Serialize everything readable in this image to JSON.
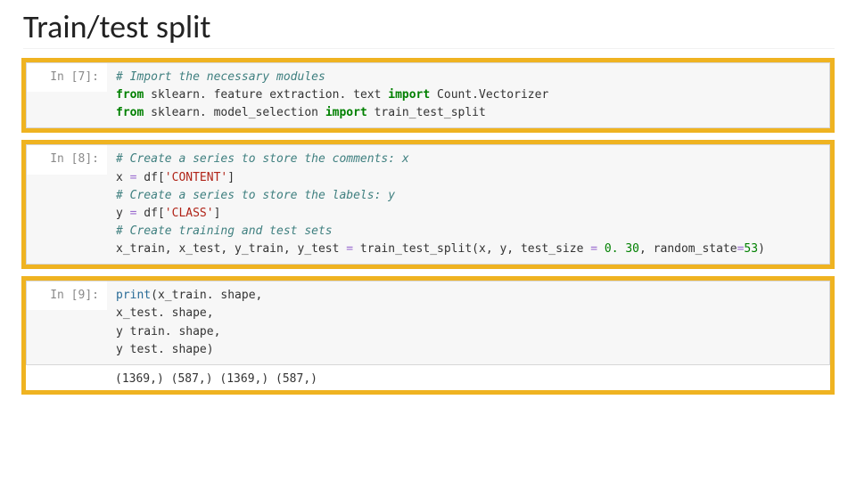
{
  "title": "Train/test split",
  "cells": [
    {
      "prompt": "In [7]:",
      "code": [
        {
          "type": "comment",
          "text": "# Import the necessary modules"
        },
        {
          "type": "import",
          "from": "from",
          "module": " sklearn. feature extraction. text ",
          "import": "import",
          "names": " Count.Vectorizer"
        },
        {
          "type": "import",
          "from": "from",
          "module": " sklearn. model_selection ",
          "import": "import",
          "names": " train_test_split"
        }
      ]
    },
    {
      "prompt": "In [8]:",
      "code": [
        {
          "type": "comment",
          "text": "# Create a series to store the comments: x"
        },
        {
          "type": "assign",
          "lhs": "x ",
          "eq": "=",
          "rhs_pre": " df[",
          "str": "'CONTENT'",
          "rhs_post": "]"
        },
        {
          "type": "comment",
          "text": "# Create a series to store the labels: y"
        },
        {
          "type": "assign",
          "lhs": "y ",
          "eq": "=",
          "rhs_pre": " df[",
          "str": "'CLASS'",
          "rhs_post": "]"
        },
        {
          "type": "comment",
          "text": "# Create training and test sets"
        },
        {
          "type": "call_tts",
          "lhs": "x_train, x_test, y_train, y_test ",
          "eq": "=",
          "mid": " train_test_split(x, y, test_size ",
          "eq2": "=",
          "sp1": " ",
          "num1": "0. 30",
          "mid2": ", random_state",
          "eq3": "=",
          "num2": "53",
          "tail": ")"
        }
      ]
    },
    {
      "prompt": "In [9]:",
      "code": [
        {
          "type": "print_open",
          "fn": "print",
          "after": "(x_train. shape,"
        },
        {
          "type": "plain",
          "text": "x_test. shape,"
        },
        {
          "type": "plain",
          "text": "y train. shape,"
        },
        {
          "type": "plain",
          "text": "y test. shape)"
        }
      ],
      "output": "(1369,) (587,) (1369,) (587,)"
    }
  ]
}
